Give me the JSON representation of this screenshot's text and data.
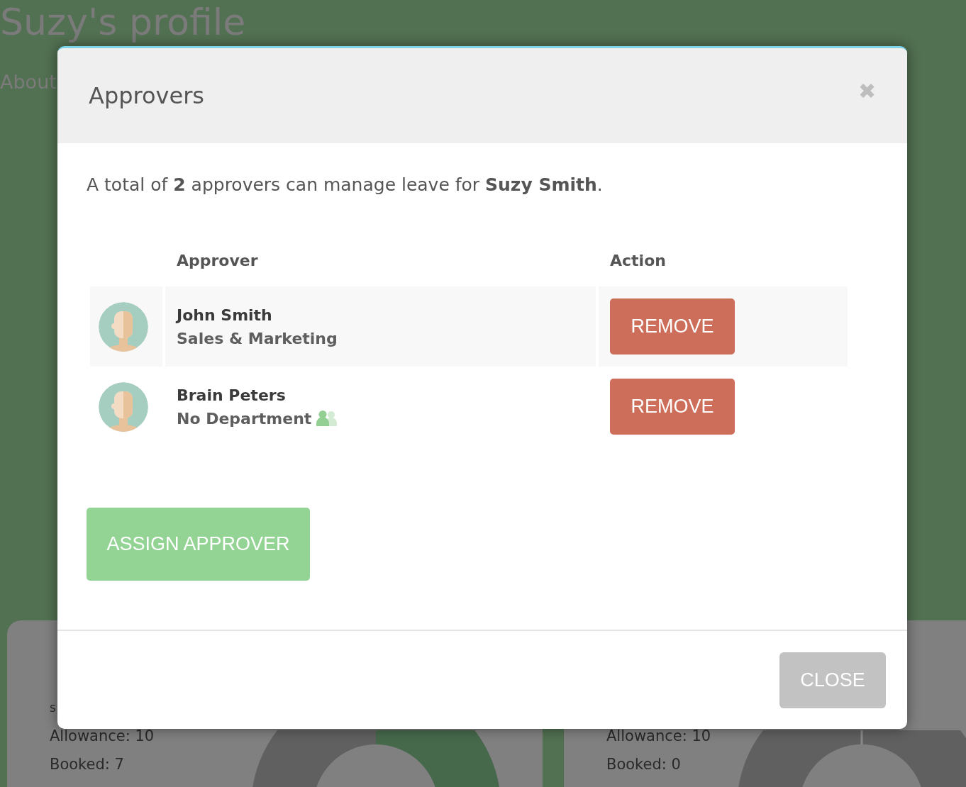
{
  "page": {
    "title": "Suzy's profile",
    "tab": "About",
    "cards": [
      {
        "subtitle": "s",
        "lines": [
          "Allowance: 10",
          "Booked: 7"
        ],
        "used_segment": true
      },
      {
        "lines": [
          "Allowance: 10",
          "Booked: 0"
        ],
        "used_segment": false
      }
    ]
  },
  "dialog": {
    "title": "Approvers",
    "close_icon": "✖",
    "summary": "A total of **2** approvers can manage leave for **Suzy Smith**.",
    "table": {
      "columns": [
        "Approver",
        "Action"
      ],
      "rows": [
        {
          "name": "John Smith",
          "department": "Sales & Marketing",
          "group_icon": false,
          "action": "REMOVE"
        },
        {
          "name": "Brain Peters",
          "department": "No Department",
          "group_icon": true,
          "action": "REMOVE"
        }
      ]
    },
    "assign_button": "ASSIGN APPROVER",
    "close_button": "CLOSE"
  }
}
